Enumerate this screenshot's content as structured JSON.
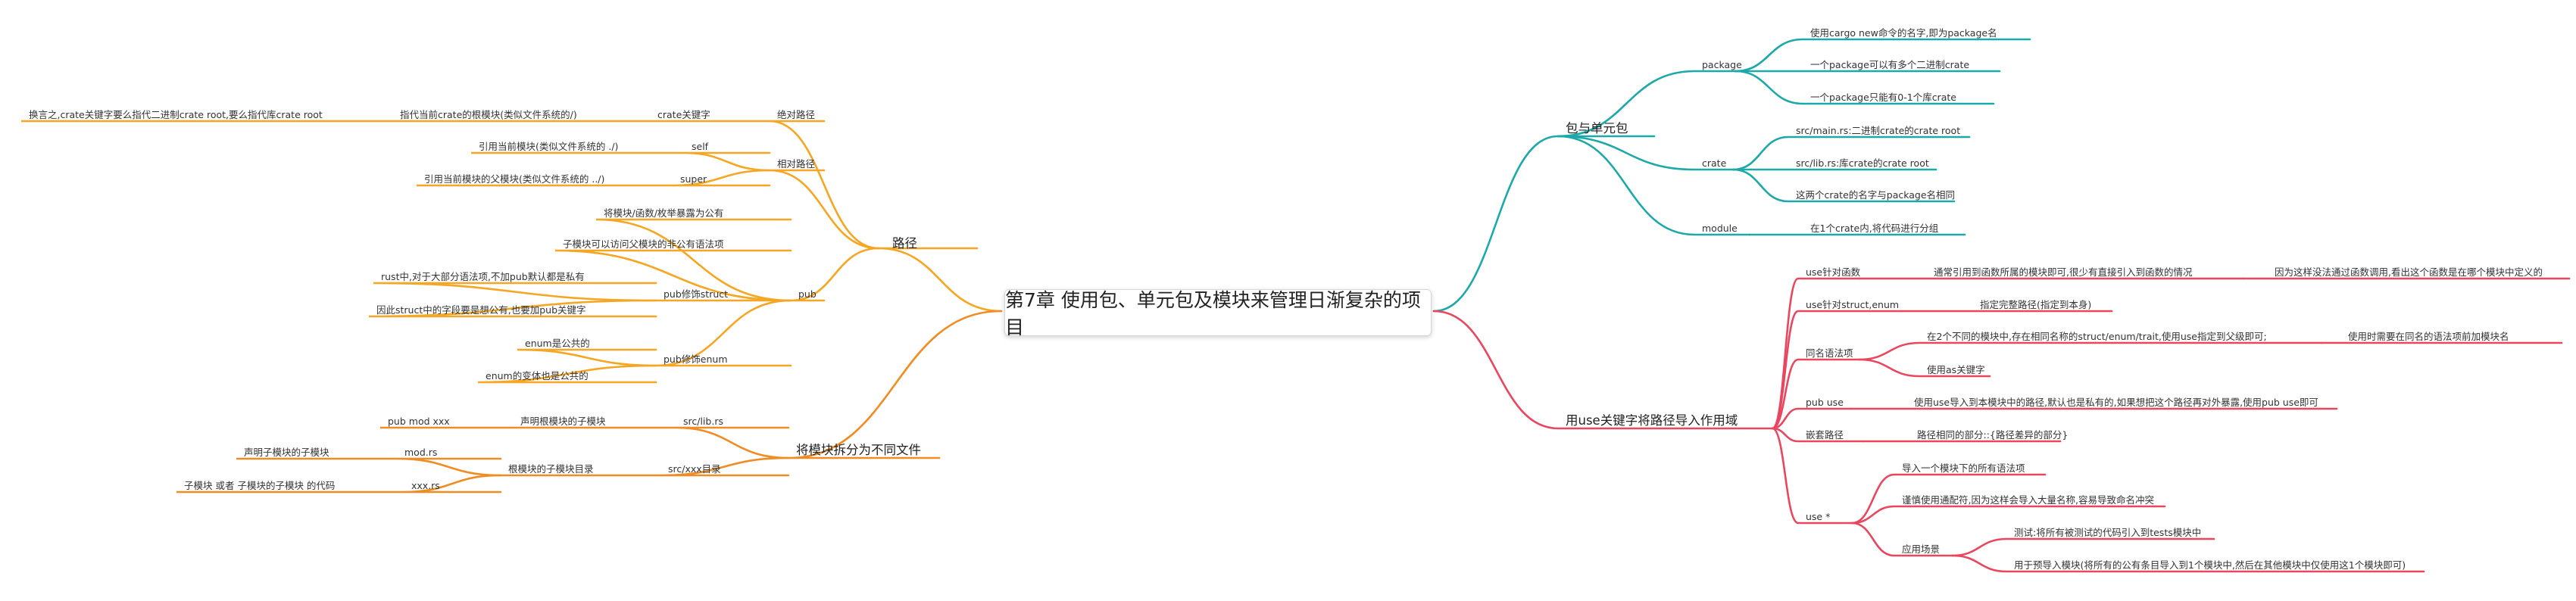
{
  "root": "第7章 使用包、单元包及模块来管理日渐复杂的项目",
  "colors": {
    "path": "#f5a623",
    "files": "#f08c24",
    "package": "#1ea8a8",
    "use": "#e8475f",
    "root_border": "#d8d8d8",
    "text": "#333333"
  },
  "path": {
    "label": "路径",
    "absolute": {
      "label": "绝对路径",
      "keyword": "crate关键字",
      "desc": "指代当前crate的根模块(类似文件系统的/)",
      "note": "换言之,crate关键字要么指代二进制crate root,要么指代库crate root"
    },
    "relative": {
      "label": "相对路径",
      "self": "self",
      "self_desc": "引用当前模块(类似文件系统的 ./)",
      "super": "super",
      "super_desc": "引用当前模块的父模块(类似文件系统的 ../)"
    },
    "pub": {
      "label": "pub",
      "expose": "将模块/函数/枚举暴露为公有",
      "child_access": "子模块可以访问父模块的非公有语法项",
      "struct": {
        "label": "pub修饰struct",
        "item1": "rust中,对于大部分语法项,不加pub默认都是私有",
        "item2": "因此struct中的字段要是想公有,也要加pub关键字"
      },
      "enum": {
        "label": "pub修饰enum",
        "item1": "enum是公共的",
        "item2": "enum的变体也是公共的"
      }
    }
  },
  "files": {
    "label": "将模块拆分为不同文件",
    "lib": {
      "label": "src/lib.rs",
      "child": "声明根模块的子模块",
      "leaf": "pub mod xxx"
    },
    "dir": {
      "label": "src/xxx目录",
      "child": "根模块的子模块目录",
      "mod": "mod.rs",
      "mod_desc": "声明子模块的子模块",
      "xxx": "xxx.rs",
      "xxx_desc": "子模块 或者 子模块的子模块 的代码"
    }
  },
  "package_unit": {
    "label": "包与单元包",
    "package": {
      "label": "package",
      "items": [
        "使用cargo new命令的名字,即为package名",
        "一个package可以有多个二进制crate",
        "一个package只能有0-1个库crate"
      ]
    },
    "crate": {
      "label": "crate",
      "items": [
        "src/main.rs:二进制crate的crate root",
        "src/lib.rs:库crate的crate root",
        "这两个crate的名字与package名相同"
      ]
    },
    "module": {
      "label": "module",
      "desc": "在1个crate内,将代码进行分组"
    }
  },
  "use_scope": {
    "label": "用use关键字将路径导入作用域",
    "fn": {
      "label": "use针对函数",
      "desc": "通常引用到函数所属的模块即可,很少有直接引入到函数的情况",
      "reason": "因为这样没法通过函数调用,看出这个函数是在哪个模块中定义的"
    },
    "struct_enum": {
      "label": "use针对struct,enum",
      "desc": "指定完整路径(指定到本身)"
    },
    "same_name": {
      "label": "同名语法项",
      "desc": "在2个不同的模块中,存在相同名称的struct/enum/trait,使用use指定到父级即可;",
      "note": "使用时需要在同名的语法项前加模块名",
      "as": "使用as关键字"
    },
    "pub_use": {
      "label": "pub use",
      "desc": "使用use导入到本模块中的路径,默认也是私有的,如果想把这个路径再对外暴露,使用pub use即可"
    },
    "nested": {
      "label": "嵌套路径",
      "desc": "路径相同的部分::{路径差异的部分}"
    },
    "glob": {
      "label": "use *",
      "all": "导入一个模块下的所有语法项",
      "caution": "谨慎使用通配符,因为这样会导入大量名称,容易导致命名冲突",
      "scene": {
        "label": "应用场景",
        "test": "测试:将所有被测试的代码引入到tests模块中",
        "prelude": "用于预导入模块(将所有的公有条目导入到1个模块中,然后在其他模块中仅使用这1个模块即可)"
      }
    }
  }
}
